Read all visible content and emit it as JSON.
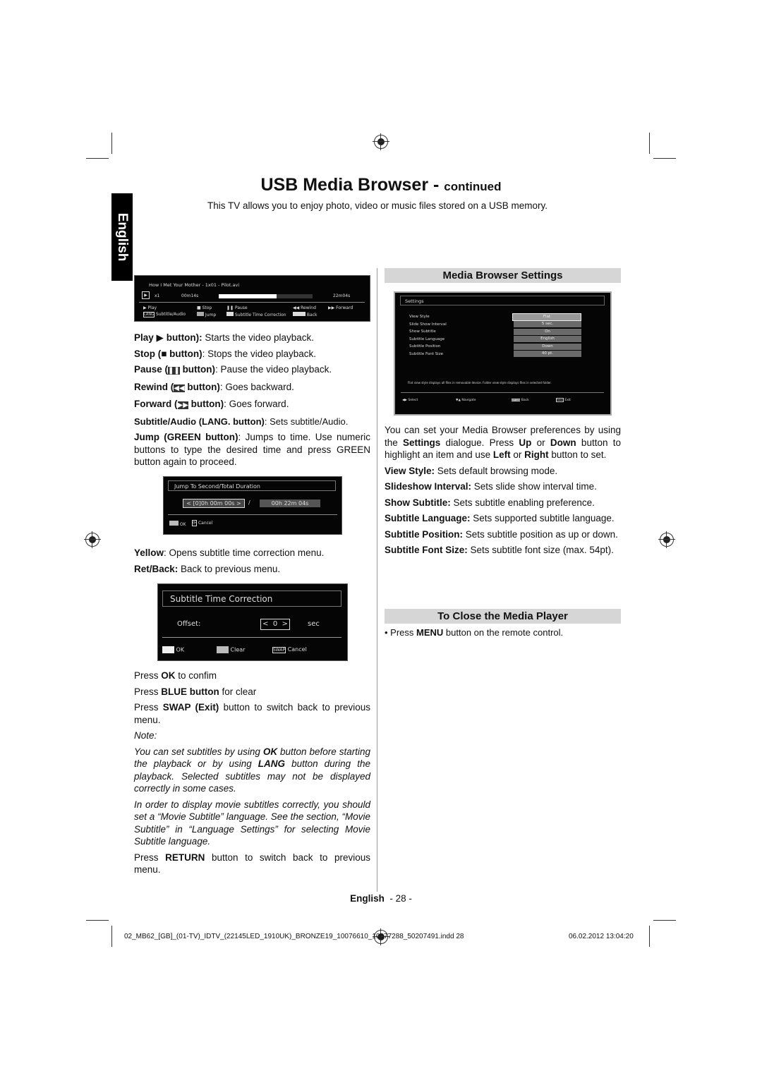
{
  "title": {
    "main": "USB Media Browser - ",
    "sub": "continued"
  },
  "intro": "This TV allows you to enjoy photo, video or music files stored on a USB memory.",
  "side_tab": "English",
  "player": {
    "file": "How I Met Your Mother - 1x01 - Pilot.avi",
    "speed": "x1",
    "elapsed": "00m14s",
    "total": "22m04s",
    "progress": 0.62,
    "legend": [
      "Play",
      "Stop",
      "Pause",
      "Rewind",
      "Forward",
      "Subtitle/Audio",
      "Jump",
      "Subtitle Time Correction",
      "Back"
    ],
    "lang_key": "LANG"
  },
  "left": {
    "play": {
      "b": "Play",
      "b2": "button):",
      "t": " Starts the video playback."
    },
    "stop": {
      "b": "Stop (",
      "b2": "button)",
      "t": ": Stops the video playback."
    },
    "pause": {
      "b": "Pause (",
      "b2": "button)",
      "t": ": Pause the video playback."
    },
    "rewind": {
      "b": "Rewind (",
      "b2": "button)",
      "t": ": Goes backward."
    },
    "forward": {
      "b": "Forward (",
      "b2": "button)",
      "t": ": Goes forward."
    },
    "subtitle": {
      "b": "Subtitle/Audio (LANG. button)",
      "t": ": Sets subtitle/Audio."
    },
    "jump": {
      "b": "Jump (GREEN button)",
      "t": ": Jumps to time. Use numeric buttons to type the desired time and press GREEN button again to proceed."
    },
    "yellow": {
      "b": "Yellow",
      "t": ": Opens subtitle time correction menu."
    },
    "ret": {
      "b": "Ret/Back:",
      "t": " Back to previous menu."
    },
    "ok": {
      "a": "Press ",
      "b": "OK",
      "t": " to confim"
    },
    "blue": {
      "a": "Press ",
      "b": "BLUE button",
      "t": " for clear"
    },
    "swap": {
      "a": "Press ",
      "b": "SWAP (Exit)",
      "t": " button to switch back to previous menu."
    },
    "note": "Note:",
    "note1": {
      "a": "You can set subtitles by using ",
      "b": "OK",
      "c": " button before starting the playback or by using ",
      "d": "LANG",
      "e": " button during the playback. Selected subtitles may not be displayed correctly in some cases."
    },
    "note2": "In order to display movie subtitles correctly, you should set a “Movie Subtitle” language. See the section, “Movie Subtitle” in “Language Settings” for selecting Movie Subtitle language.",
    "return": {
      "a": "Press ",
      "b": "RETURN",
      "t": " button to switch back to previous menu."
    }
  },
  "jump_dialog": {
    "title": "Jump To Second/Total Duration",
    "value": "[0]0h 00m 00s",
    "sep": "/",
    "total": "00h 22m 04s",
    "ok": "OK",
    "cancel": "Cancel"
  },
  "stc_dialog": {
    "title": "Subtitle Time Correction",
    "label": "Offset:",
    "value": "0",
    "unit": "sec",
    "ok": "OK",
    "clear": "Clear",
    "swap_key": "SWAP",
    "cancel": "Cancel"
  },
  "right": {
    "settings_header": "Media Browser Settings",
    "intro": {
      "a": "You can set your Media Browser preferences by using the ",
      "b": "Settings",
      "c": " dialogue. Press ",
      "d": "Up",
      "e": " or ",
      "f": "Down",
      "g": " button to highlight an item and use ",
      "h": "Left",
      "i": " or ",
      "j": "Right",
      "k": " button to set."
    },
    "items": [
      {
        "b": "View Style:",
        "t": " Sets default browsing mode."
      },
      {
        "b": "Slideshow Interval:",
        "t": " Sets slide show interval time."
      },
      {
        "b": "Show Subtitle:",
        "t": " Sets subtitle enabling preference."
      },
      {
        "b": "Subtitle Language:",
        "t": " Sets supported subtitle language."
      },
      {
        "b": "Subtitle Position:",
        "t": " Sets subtitle position as up or down."
      },
      {
        "b": "Subtitle Font Size:",
        "t": " Sets subtitle font size (max. 54pt)."
      }
    ],
    "close_header": "To Close the Media Player",
    "close": {
      "a": "Press ",
      "b": "MENU",
      "t": " button on the remote control."
    }
  },
  "settings_dialog": {
    "title": "Settings",
    "rows": [
      {
        "label": "View Style",
        "value": "Flat"
      },
      {
        "label": "Slide Show Interval",
        "value": "5 sec."
      },
      {
        "label": "Show Subtitle",
        "value": "On"
      },
      {
        "label": "Subtitle Language",
        "value": "English"
      },
      {
        "label": "Subtitle Position",
        "value": "Down"
      },
      {
        "label": "Subtitle Font Size",
        "value": "40 pt."
      }
    ],
    "hint": "Flat view style displays all files in removable device. Folder view style displays files in selected folder.",
    "footer": [
      "Select",
      "Navigate",
      "Back",
      "Exit"
    ],
    "return_key": "RETURN",
    "menu_key": "MENU"
  },
  "page_footer": {
    "lang": "English",
    "num": "- 28 -"
  },
  "print_slug": {
    "file": "02_MB62_[GB]_(01-TV)_IDTV_(22145LED_1910UK)_BRONZE19_10076610_10077288_50207491.indd   28",
    "date": "06.02.2012   13:04:20"
  }
}
